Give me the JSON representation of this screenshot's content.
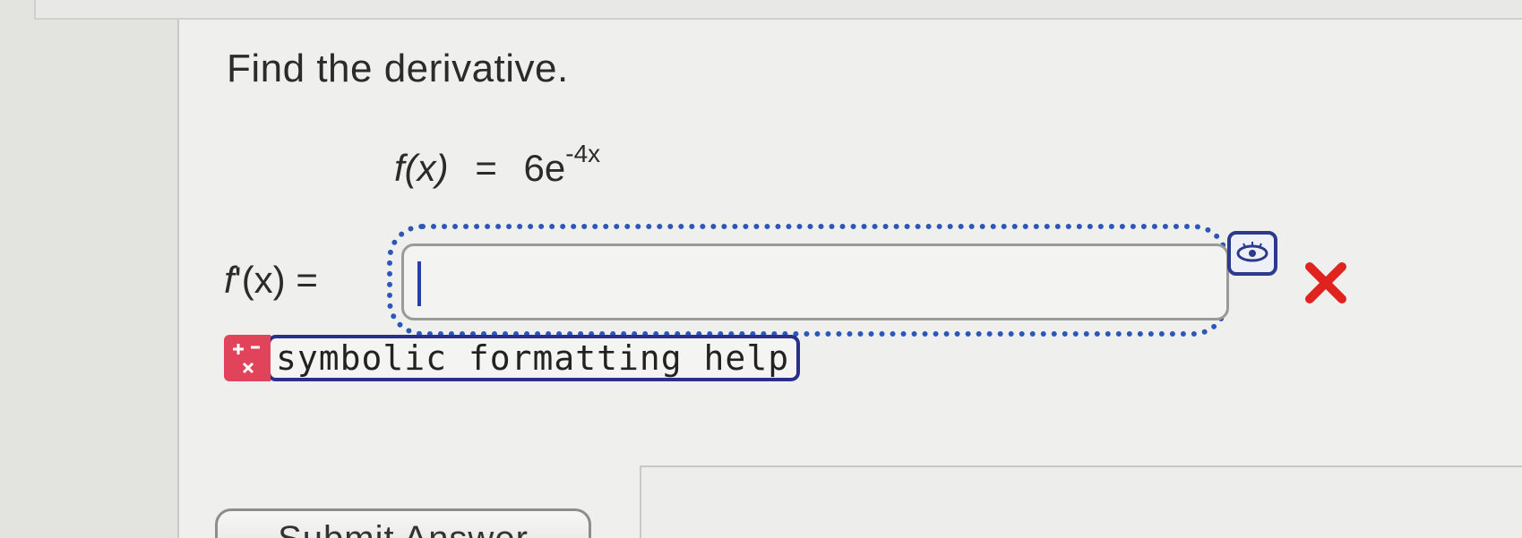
{
  "question": {
    "prompt": "Find the derivative."
  },
  "function": {
    "lhs": "f(x)",
    "eq": "=",
    "coef": "6e",
    "exponent": "-4x"
  },
  "answer": {
    "label_f": "f",
    "label_rest": "'(x) =",
    "value": "",
    "status": "incorrect",
    "status_color": "#e0231f"
  },
  "help": {
    "label": "symbolic formatting help",
    "icon": "plus-minus-times-icon"
  },
  "preview": {
    "icon": "eye-icon"
  },
  "submit": {
    "label": "Submit Answer"
  },
  "colors": {
    "focus": "#2b57b8",
    "help_icon_bg": "#e0435a",
    "help_border": "#2a2f8c"
  }
}
